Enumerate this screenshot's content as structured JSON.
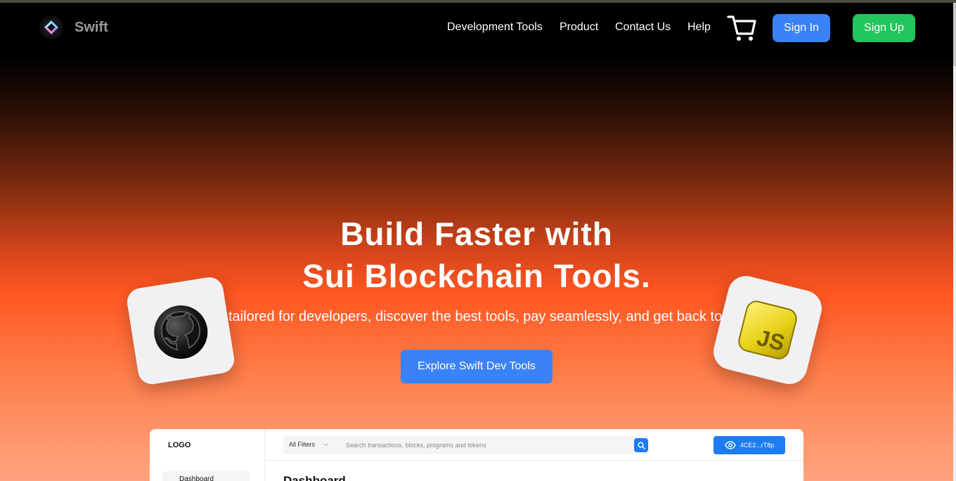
{
  "brand": {
    "name": "Swift",
    "logo_icon": "diamond-logo-icon"
  },
  "nav": {
    "links": [
      "Development Tools",
      "Product",
      "Contact Us",
      "Help"
    ],
    "cart_icon": "shopping-cart-icon",
    "sign_in": "Sign In",
    "sign_up": "Sign Up"
  },
  "hero": {
    "title_line1": "Build Faster with",
    "title_line2": "Sui Blockchain Tools.",
    "subtitle": "tailored for developers, discover the best tools, pay seamlessly, and get back to b",
    "cta": "Explore Swift Dev Tools"
  },
  "floating_cards": {
    "left_icon": "github-icon",
    "right_icon": "javascript-icon",
    "right_label": "JS"
  },
  "dashboard_preview": {
    "logo": "LOGO",
    "filter": "All Filters",
    "search_placeholder": "Search transactions, blocks, programs and tokens",
    "wallet": "4CE2...rT8p",
    "sidebar_item": "Dashboard",
    "title": "Dashboard"
  },
  "colors": {
    "sign_in_bg": "#3b82f6",
    "sign_up_bg": "#22c55e",
    "hero_accent": "#ff5722",
    "dashboard_accent": "#1d7cf2"
  }
}
